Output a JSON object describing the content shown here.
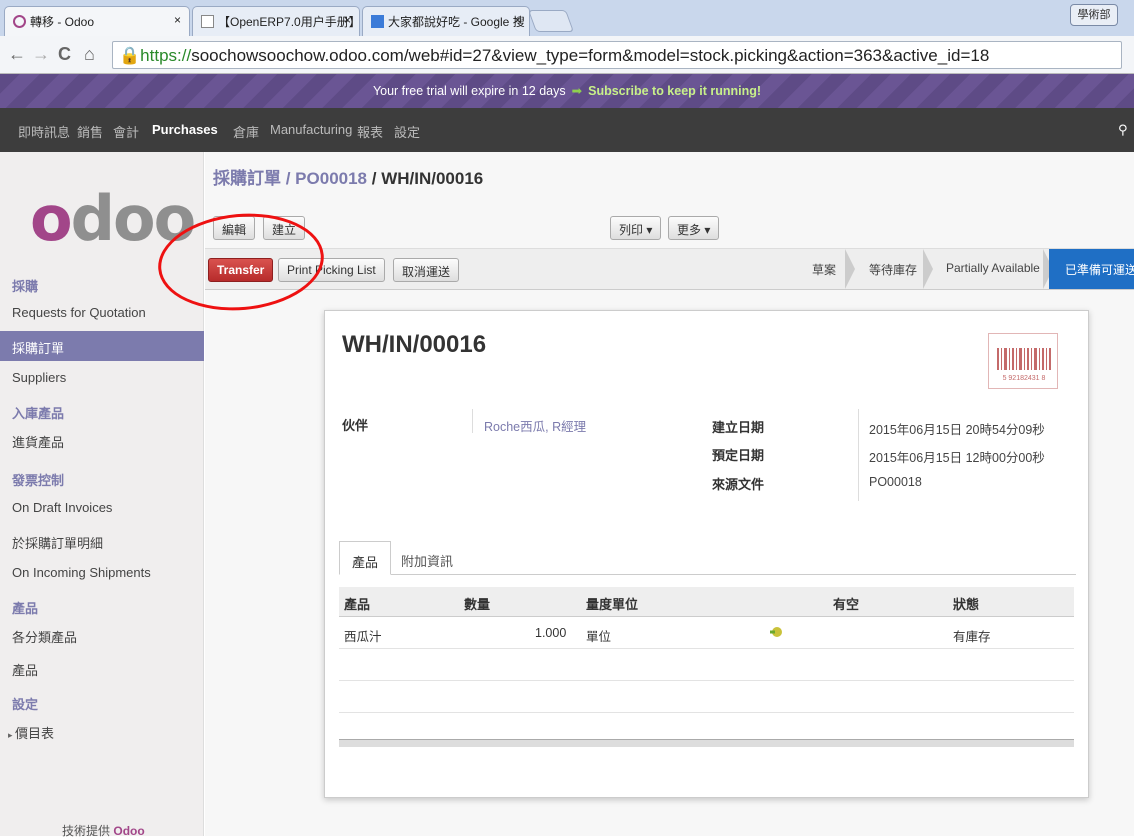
{
  "browser": {
    "tabs": [
      {
        "title": "轉移 - Odoo",
        "active": true
      },
      {
        "title": "【OpenERP7.0用户手册】",
        "active": false
      },
      {
        "title": "大家都說好吃 - Google 搜",
        "active": false
      }
    ],
    "user_chip": "學術部",
    "url_scheme": "https://",
    "url_rest": "soochowsoochow.odoo.com/web#id=27&view_type=form&model=stock.picking&action=363&active_id=18"
  },
  "trial": {
    "text": "Your free trial will expire in 12 days",
    "cta": "Subscribe to keep it running!"
  },
  "topmenu": [
    "即時訊息",
    "銷售",
    "會計",
    "Purchases",
    "倉庫",
    "Manufacturing",
    "報表",
    "設定"
  ],
  "sidebar": {
    "logo": "odoo",
    "sections": [
      {
        "title": "採購",
        "items": [
          "Requests for Quotation",
          "採購訂單",
          "Suppliers"
        ]
      },
      {
        "title": "入庫產品",
        "items": [
          "進貨產品"
        ]
      },
      {
        "title": "發票控制",
        "items": [
          "On Draft Invoices",
          "於採購訂單明細",
          "On Incoming Shipments"
        ]
      },
      {
        "title": "產品",
        "items": [
          "各分類產品",
          "產品"
        ]
      },
      {
        "title": "設定",
        "items": [
          "價目表"
        ]
      }
    ],
    "powered_prefix": "技術提供",
    "powered_brand": "Odoo"
  },
  "breadcrumb": {
    "part1": "採購訂單",
    "sep": " / ",
    "part2": "PO00018",
    "part3": "WH/IN/00016"
  },
  "toolbar": {
    "edit": "編輯",
    "create": "建立",
    "print": "列印 ▾",
    "more": "更多 ▾"
  },
  "actions": {
    "transfer": "Transfer",
    "print_picking": "Print Picking List",
    "cancel": "取消運送"
  },
  "statusbar": [
    "草案",
    "等待庫存",
    "Partially Available",
    "已準備可運送"
  ],
  "record": {
    "title": "WH/IN/00016",
    "partner_label": "伙伴",
    "partner_value": "Roche西瓜, R經理",
    "created_label": "建立日期",
    "created_value": "2015年06月15日 20時54分09秒",
    "scheduled_label": "預定日期",
    "scheduled_value": "2015年06月15日 12時00分00秒",
    "source_label": "來源文件",
    "source_value": "PO00018",
    "barcode_text": "5 92182431 8"
  },
  "notebook": {
    "tabs": [
      "產品",
      "附加資訊"
    ]
  },
  "lines": {
    "headers": [
      "產品",
      "數量",
      "量度單位",
      "有空",
      "狀態"
    ],
    "rows": [
      {
        "product": "西瓜汁",
        "qty": "1.000",
        "uom": "單位",
        "status": "有庫存"
      }
    ]
  },
  "colors": {
    "brand": "#7c7bad",
    "odoo_purple": "#a24689",
    "primary_button": "#c9302c",
    "active_stage": "#1f6fc5",
    "annotation": "#e11111"
  }
}
